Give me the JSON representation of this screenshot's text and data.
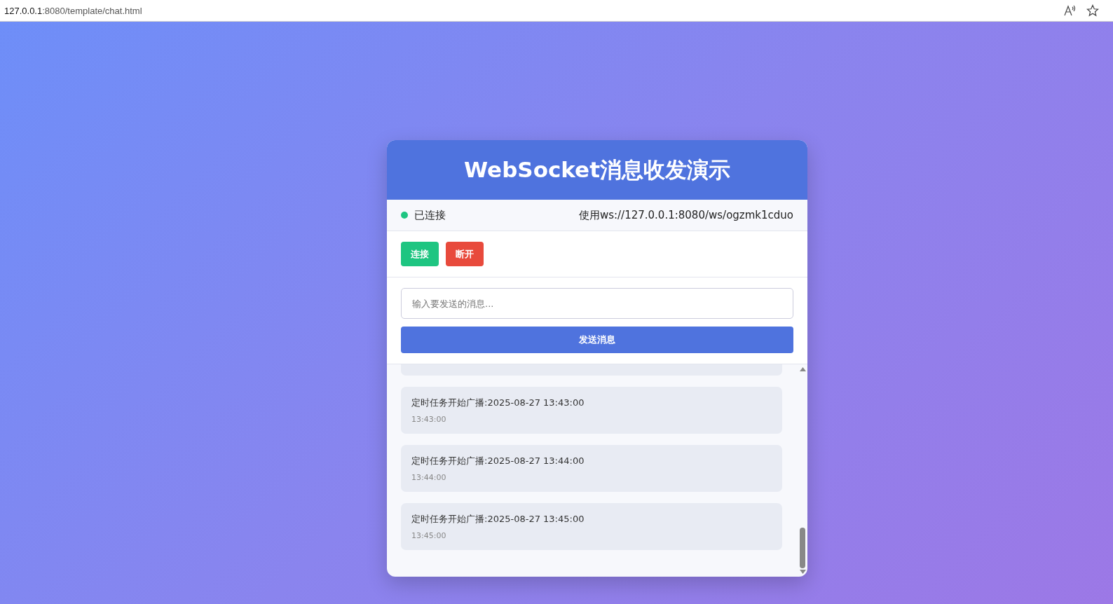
{
  "browser": {
    "address_host": "127.0.0.1",
    "address_path": ":8080/template/chat.html"
  },
  "chat": {
    "title": "WebSocket消息收发演示",
    "status": {
      "connected": true,
      "label": "已连接",
      "endpoint": "使用ws://127.0.0.1:8080/ws/ogzmk1cduo"
    },
    "buttons": [
      {
        "label": "连接",
        "kind": "connect"
      },
      {
        "label": "断开",
        "kind": "disconnect"
      }
    ],
    "input": {
      "placeholder": "输入要发送的消息..."
    },
    "send_button": "发送消息",
    "messages": [
      {
        "text": "定时任务开始广播:2025-08-27 13:43:00",
        "time": "13:43:00"
      },
      {
        "text": "定时任务开始广播:2025-08-27 13:44:00",
        "time": "13:44:00"
      },
      {
        "text": "定时任务开始广播:2025-08-27 13:45:00",
        "time": "13:45:00"
      }
    ]
  }
}
